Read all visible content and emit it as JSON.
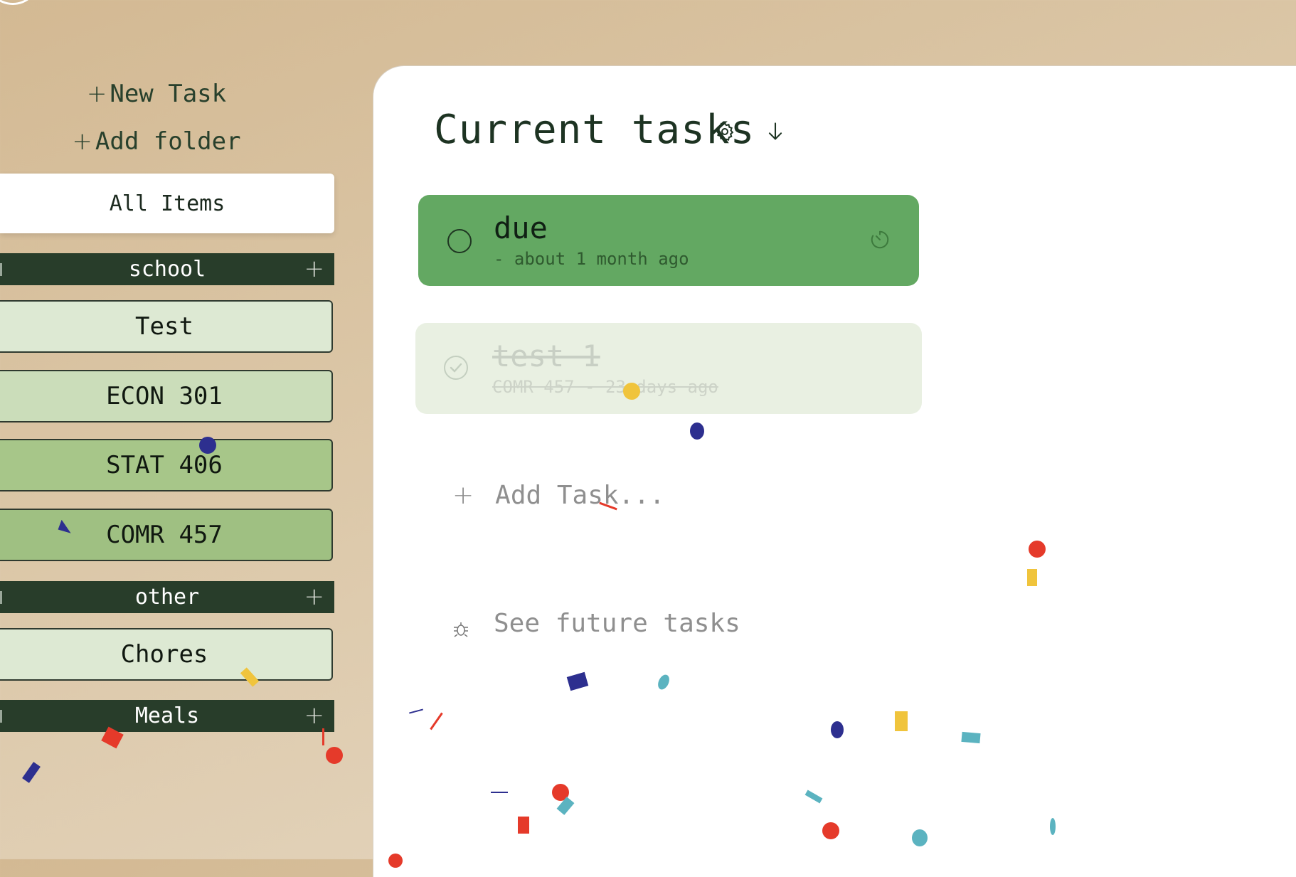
{
  "sidebar": {
    "new_task": "New Task",
    "add_folder": "Add folder",
    "all_items": "All Items",
    "folders": [
      {
        "name": "school",
        "items": [
          "Test",
          "ECON 301",
          "STAT 406",
          "COMR 457"
        ]
      },
      {
        "name": "other",
        "items": [
          "Chores"
        ]
      },
      {
        "name": "Meals",
        "items": []
      }
    ]
  },
  "main": {
    "title": "Current tasks",
    "tasks": [
      {
        "title": "due",
        "subtitle": "- about 1 month ago",
        "completed": false
      },
      {
        "title": "test 1",
        "subtitle": "COMR 457 - 23 days ago",
        "completed": true
      }
    ],
    "add_task_placeholder": "Add Task...",
    "see_future": "See future tasks"
  },
  "colors": {
    "sidebar_dark": "#283d2a",
    "task_due_bg": "#63a862",
    "task_done_bg": "#e9f0e2",
    "item_light": "#dde9d3",
    "item_mid": "#cbddba",
    "item_green": "#a7c689",
    "item_green2": "#9fc082"
  },
  "icons": {
    "settings": "gear-icon",
    "sort": "arrow-down-icon",
    "timer": "timer-icon",
    "future": "bug-icon"
  }
}
